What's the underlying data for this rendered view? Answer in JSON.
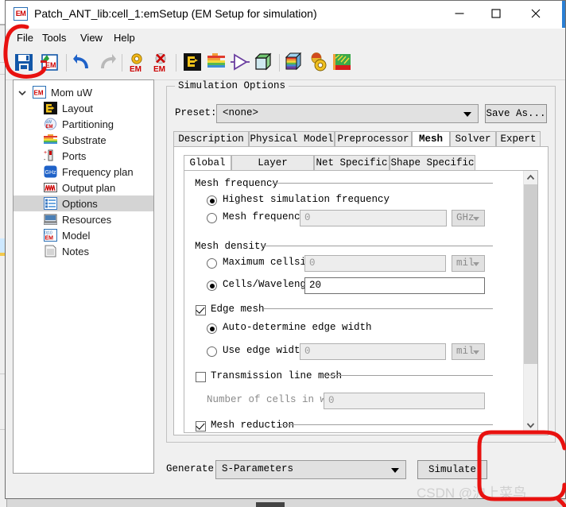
{
  "window": {
    "title": "Patch_ANT_lib:cell_1:emSetup (EM Setup for simulation)",
    "app_icon": "EM",
    "controls": {
      "minimize": "minimize-icon",
      "maximize": "maximize-icon",
      "close": "close-icon"
    }
  },
  "menu": {
    "items": [
      "File",
      "Tools",
      "View",
      "Help"
    ]
  },
  "toolbar": {
    "items": [
      {
        "name": "save-icon",
        "tip": "Save"
      },
      {
        "name": "save-as-em-icon",
        "tip": "Save a copy"
      },
      {
        "name": "undo-icon",
        "tip": "Undo"
      },
      {
        "name": "redo-icon",
        "tip": "Redo"
      },
      {
        "name": "em-settings-icon",
        "tip": "EM settings"
      },
      {
        "name": "em-delete-icon",
        "tip": "Delete EM setup"
      },
      {
        "name": "layout-icon",
        "tip": "Layout"
      },
      {
        "name": "substrate-icon",
        "tip": "Substrate"
      },
      {
        "name": "ports-icon",
        "tip": "Ports"
      },
      {
        "name": "mesh-cube-icon",
        "tip": "Mesh"
      },
      {
        "name": "visualization-cube-icon",
        "tip": "Visualization"
      },
      {
        "name": "simulate-icon",
        "tip": "Simulate"
      },
      {
        "name": "results-icon",
        "tip": "Results"
      }
    ]
  },
  "sidebar": {
    "root": {
      "label": "Mom uW",
      "icon": "em-root-icon",
      "expanded": true
    },
    "items": [
      {
        "label": "Layout",
        "icon": "layout-icon"
      },
      {
        "label": "Partitioning",
        "icon": "partitioning-icon"
      },
      {
        "label": "Substrate",
        "icon": "substrate-icon"
      },
      {
        "label": "Ports",
        "icon": "ports-icon"
      },
      {
        "label": "Frequency plan",
        "icon": "frequency-plan-icon"
      },
      {
        "label": "Output plan",
        "icon": "output-plan-icon"
      },
      {
        "label": "Options",
        "icon": "options-icon",
        "selected": true
      },
      {
        "label": "Resources",
        "icon": "resources-icon"
      },
      {
        "label": "Model",
        "icon": "model-icon"
      },
      {
        "label": "Notes",
        "icon": "notes-icon"
      }
    ]
  },
  "main": {
    "group_title": "Simulation Options",
    "preset": {
      "label": "Preset:",
      "value": "<none>",
      "save_as": "Save As..."
    },
    "tabs": [
      {
        "label": "Description",
        "active": false
      },
      {
        "label": "Physical Model",
        "active": false
      },
      {
        "label": "Preprocessor",
        "active": false
      },
      {
        "label": "Mesh",
        "active": true
      },
      {
        "label": "Solver",
        "active": false
      },
      {
        "label": "Expert",
        "active": false
      }
    ],
    "subtabs": [
      {
        "label": "Global",
        "active": true
      },
      {
        "label": "Layer Specific",
        "active": false
      },
      {
        "label": "Net Specific",
        "active": false
      },
      {
        "label": "Shape Specific",
        "active": false
      }
    ],
    "mesh": {
      "frequency_section": "Mesh frequency",
      "highest_sim_freq": {
        "label": "Highest simulation frequency",
        "checked": true
      },
      "mesh_freq": {
        "label": "Mesh frequency",
        "checked": false,
        "value": "0",
        "unit": "GHz"
      },
      "density_section": "Mesh density",
      "max_cellsize": {
        "label": "Maximum cellsize",
        "checked": false,
        "value": "0",
        "unit": "mil"
      },
      "cells_per_wavelength": {
        "label": "Cells/Wavelength",
        "checked": true,
        "value": "20"
      },
      "edge_mesh": {
        "label": "Edge mesh",
        "checked": true
      },
      "auto_edge_width": {
        "label": "Auto-determine edge width",
        "checked": true
      },
      "use_edge_width": {
        "label": "Use edge width",
        "checked": false,
        "value": "0",
        "unit": "mil"
      },
      "transmission_line_mesh": {
        "label": "Transmission line mesh",
        "checked": false
      },
      "num_cells_in_width": {
        "label": "Number of cells in width",
        "value": "0"
      },
      "mesh_reduction": {
        "label": "Mesh reduction",
        "checked": true
      }
    }
  },
  "footer": {
    "generate_label": "Generate:",
    "generate_value": "S-Parameters",
    "simulate_button": "Simulate"
  },
  "watermark": "CSDN @沪上菜鸟",
  "annotations": {
    "save_circle_color": "#e8110f",
    "simulate_box_color": "#e8110f"
  }
}
